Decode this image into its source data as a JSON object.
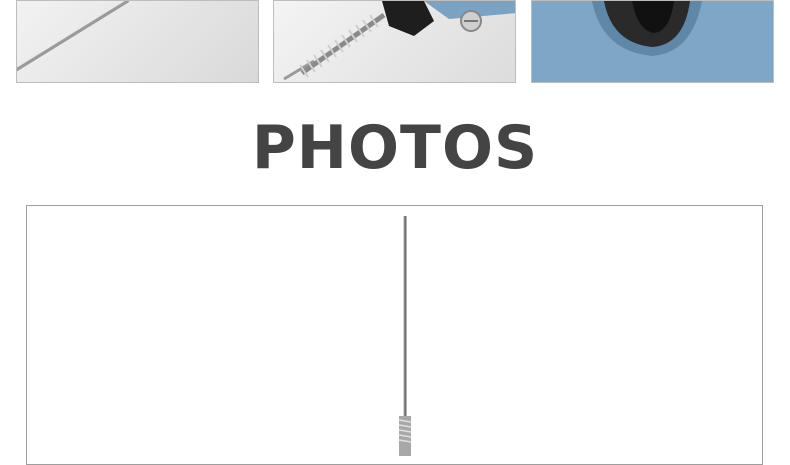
{
  "heading": {
    "text": "PHOTOS"
  },
  "thumbnails": [
    {
      "name": "rod-detail",
      "icon": "steel-rod-image"
    },
    {
      "name": "spring-detail",
      "icon": "spring-rod-image"
    },
    {
      "name": "housing-detail",
      "icon": "threaded-port-image"
    }
  ],
  "main_photo": {
    "icon": "limit-switch-rod-image"
  },
  "colors": {
    "heading": "#444444",
    "housing_blue": "#7aa2c2",
    "border": "#bdbdbd"
  }
}
